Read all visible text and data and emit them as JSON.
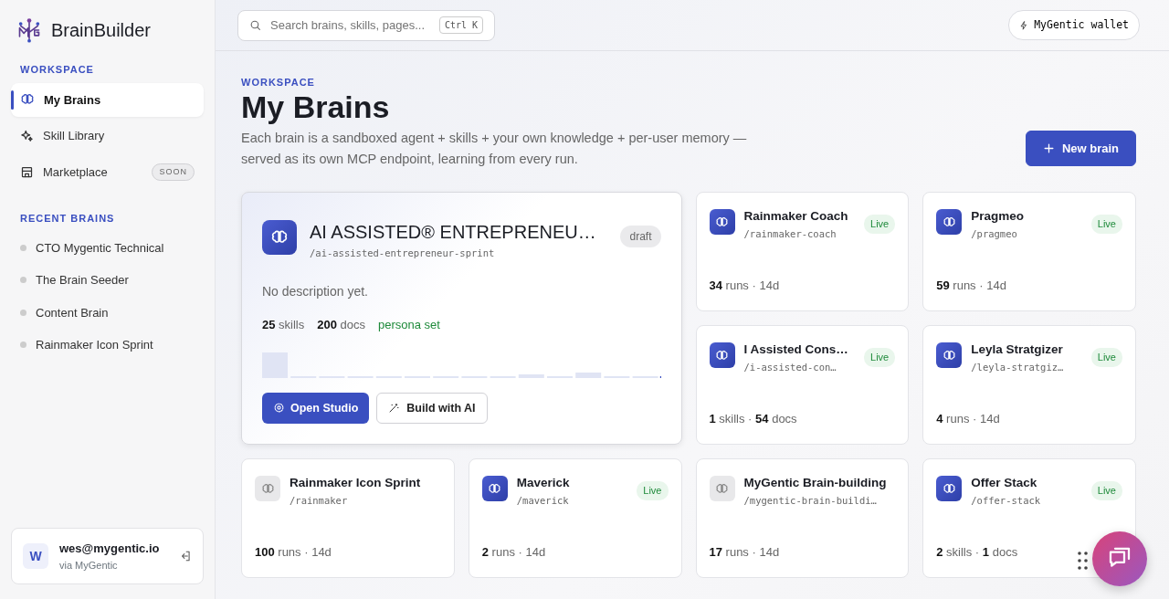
{
  "sidebar": {
    "brand": "BrainBuilder",
    "sections": [
      {
        "title": "WORKSPACE",
        "kind": "nav",
        "items": [
          {
            "label": "My Brains",
            "selected": true
          },
          {
            "label": "Skill Library",
            "selected": false
          },
          {
            "label": "Marketplace",
            "selected": false,
            "badge": "SOON"
          }
        ]
      },
      {
        "title": "RECENT BRAINS",
        "kind": "recent",
        "items": [
          {
            "label": "CTO Mygentic Technical"
          },
          {
            "label": "The Brain Seeder"
          },
          {
            "label": "Content Brain"
          },
          {
            "label": "Rainmaker Icon Sprint"
          }
        ]
      }
    ],
    "user": {
      "avatar": "W",
      "email": "wes@mygentic.io",
      "via": "via MyGentic"
    }
  },
  "topbar": {
    "search": {
      "placeholder": "Search brains, skills, pages...",
      "shortcut": "Ctrl K"
    },
    "wallet": "MyGentic wallet"
  },
  "header": {
    "eyebrow": "WORKSPACE",
    "title": "My Brains",
    "description": "Each brain is a sandboxed agent + skills + your own knowledge + per-user memory — served as its own MCP endpoint, learning from every run.",
    "new_button": "New brain"
  },
  "featured": {
    "title": "AI ASSISTED® ENTREPRENEU…",
    "slug": "/ai-assisted-entrepreneur-sprint",
    "badge": "draft",
    "description": "No description yet.",
    "stats": [
      "**25** skills",
      "**200** docs"
    ],
    "persona": "persona set",
    "buttons": [
      "Open Studio",
      "Build with AI"
    ]
  },
  "cards": [
    {
      "title": "Rainmaker Coach",
      "slug": "/rainmaker-coach",
      "active": true,
      "badge": "Live",
      "stats": "**34** runs · 14d"
    },
    {
      "title": "Pragmeo",
      "slug": "/pragmeo",
      "active": true,
      "badge": "Live",
      "stats": "**59** runs · 14d"
    },
    {
      "title": "I Assisted Cons…",
      "slug": "/i-assisted-con…",
      "active": true,
      "badge": "Live",
      "stats": "**1** skills · **54** docs"
    },
    {
      "title": "Leyla Stratgizer",
      "slug": "/leyla-stratgiz…",
      "active": true,
      "badge": "Live",
      "stats": "**4** runs · 14d"
    },
    {
      "title": "Rainmaker Icon Sprint",
      "slug": "/rainmaker",
      "active": false,
      "stats": "**100** runs · 14d"
    },
    {
      "title": "Maverick",
      "slug": "/maverick",
      "active": true,
      "badge": "Live",
      "stats": "**2** runs · 14d"
    },
    {
      "title": "MyGentic Brain-building",
      "slug": "/mygentic-brain-buildi…",
      "active": false,
      "stats": "**17** runs · 14d"
    },
    {
      "title": "Offer Stack",
      "slug": "/offer-stack",
      "active": true,
      "badge": "Live",
      "stats": "**2** skills · **1** docs"
    }
  ]
}
